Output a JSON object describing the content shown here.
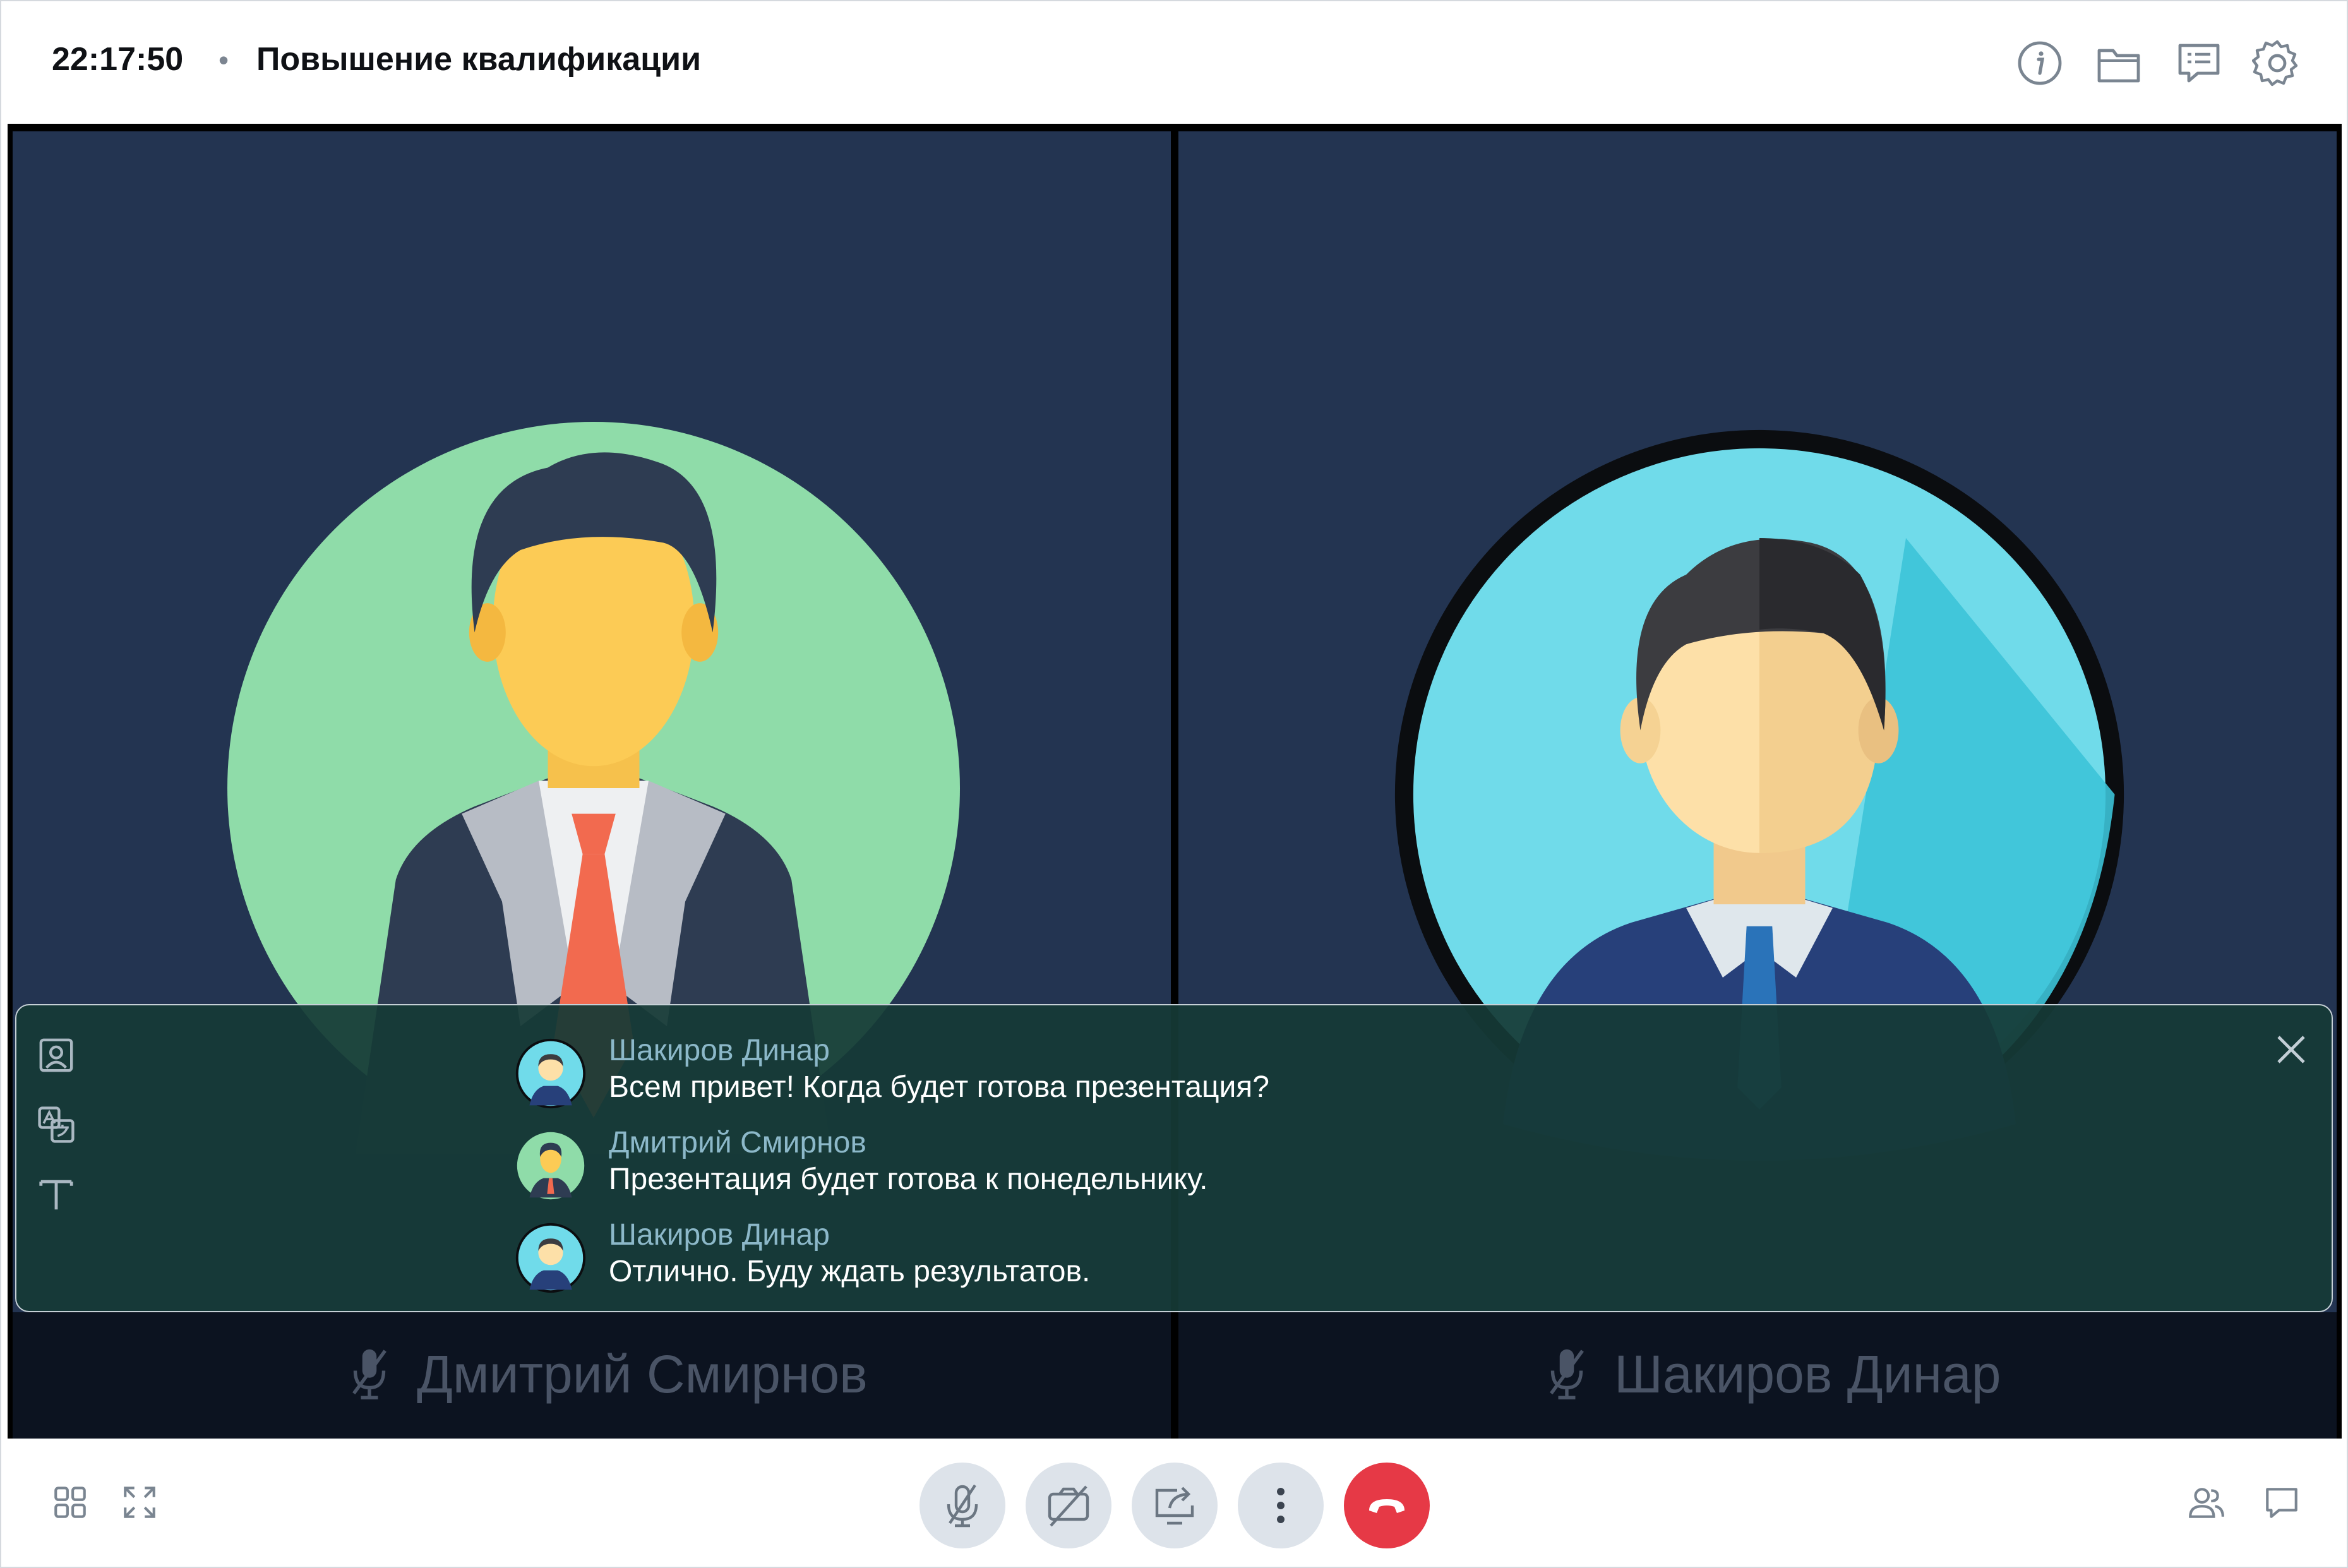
{
  "header": {
    "time": "22:17:50",
    "separator": "•",
    "title": "Повышение квалификации",
    "icons": [
      "info-icon",
      "folder-icon",
      "chat-list-icon",
      "gear-icon"
    ]
  },
  "participants": [
    {
      "name": "Дмитрий Смирнов",
      "mic": "muted",
      "avatar_color": "#8fdca9"
    },
    {
      "name": "Шакиров Динар",
      "mic": "muted",
      "avatar_color": "#70dbea"
    }
  ],
  "transcript": {
    "tools": [
      "picture-icon",
      "translate-icon",
      "text-icon"
    ],
    "messages": [
      {
        "author": "Шакиров Динар",
        "text": "Всем привет! Когда будет готова презентация?"
      },
      {
        "author": "Дмитрий Смирнов",
        "text": "Презентация будет готова к понедельнику."
      },
      {
        "author": "Шакиров Динар",
        "text": "Отлично. Буду ждать результатов."
      }
    ]
  },
  "controls": {
    "left": [
      "grid-layout-icon",
      "fullscreen-icon"
    ],
    "center": [
      "mic-off-icon",
      "camera-off-icon",
      "share-screen-icon",
      "more-icon",
      "hang-up-icon"
    ],
    "right": [
      "participants-icon",
      "chat-icon"
    ],
    "colors": {
      "button_bg": "#dde3ea",
      "hang_up": "#e63946"
    }
  }
}
